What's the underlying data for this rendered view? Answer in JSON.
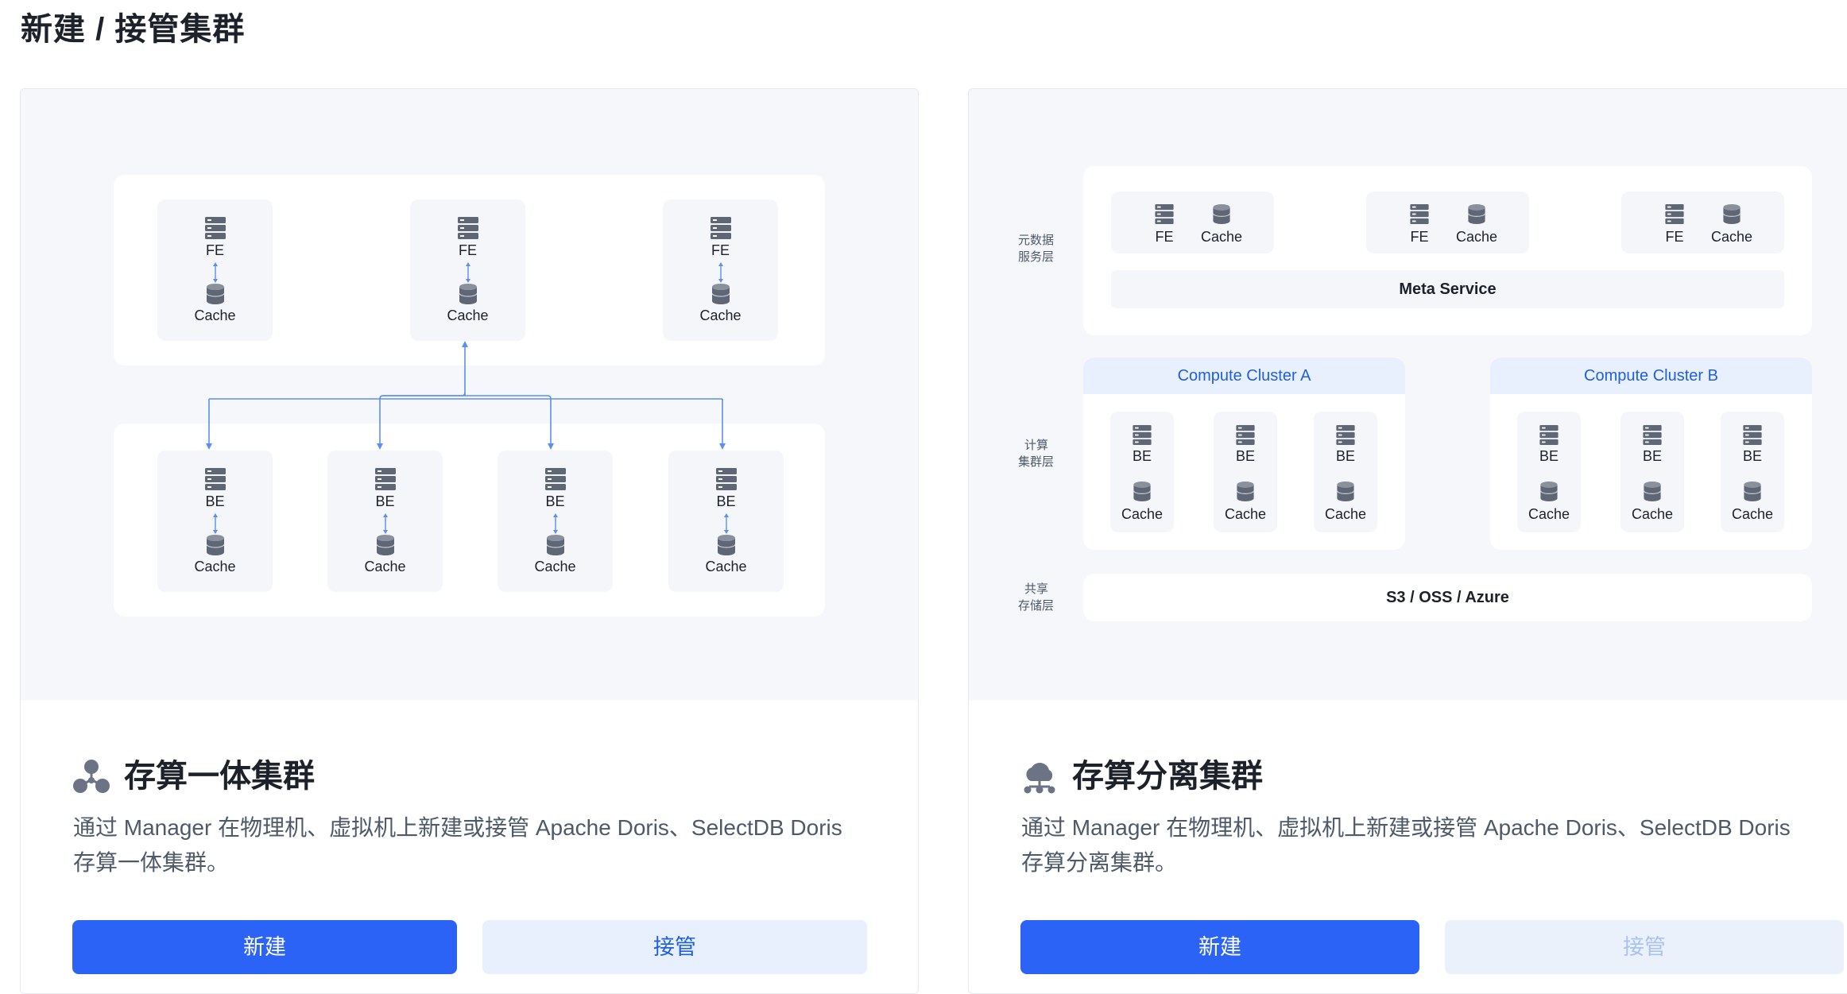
{
  "page": {
    "title": "新建 / 接管集群"
  },
  "integrated": {
    "fe_nodes": [
      {
        "label": "FE",
        "cache": "Cache"
      },
      {
        "label": "FE",
        "cache": "Cache"
      },
      {
        "label": "FE",
        "cache": "Cache"
      }
    ],
    "be_nodes": [
      {
        "label": "BE",
        "cache": "Cache"
      },
      {
        "label": "BE",
        "cache": "Cache"
      },
      {
        "label": "BE",
        "cache": "Cache"
      },
      {
        "label": "BE",
        "cache": "Cache"
      }
    ],
    "title": "存算一体集群",
    "description_line1": "通过 Manager 在物理机、虚拟机上新建或接管 Apache Doris、SelectDB Doris",
    "description_line2": "存算一体集群。",
    "create_label": "新建",
    "takeover_label": "接管"
  },
  "separated": {
    "layer_meta_line1": "元数据",
    "layer_meta_line2": "服务层",
    "layer_compute_line1": "计算",
    "layer_compute_line2": "集群层",
    "layer_storage_line1": "共享",
    "layer_storage_line2": "存储层",
    "fe_groups": [
      {
        "fe": "FE",
        "cache": "Cache"
      },
      {
        "fe": "FE",
        "cache": "Cache"
      },
      {
        "fe": "FE",
        "cache": "Cache"
      }
    ],
    "meta_service": "Meta Service",
    "cluster_a": {
      "name": "Compute Cluster A",
      "nodes": [
        {
          "label": "BE",
          "cache": "Cache"
        },
        {
          "label": "BE",
          "cache": "Cache"
        },
        {
          "label": "BE",
          "cache": "Cache"
        }
      ]
    },
    "cluster_b": {
      "name": "Compute Cluster B",
      "nodes": [
        {
          "label": "BE",
          "cache": "Cache"
        },
        {
          "label": "BE",
          "cache": "Cache"
        },
        {
          "label": "BE",
          "cache": "Cache"
        }
      ]
    },
    "storage": "S3 / OSS / Azure",
    "title": "存算分离集群",
    "description_line1": "通过 Manager 在物理机、虚拟机上新建或接管 Apache Doris、SelectDB Doris",
    "description_line2": "存算分离集群。",
    "create_label": "新建",
    "takeover_label": "接管"
  },
  "colors": {
    "primary": "#2b63f6",
    "secondary_bg": "#e8f0fd",
    "diagram_bg": "#f6f7fb",
    "line": "#5b8ff0",
    "icon": "#5f6675"
  }
}
